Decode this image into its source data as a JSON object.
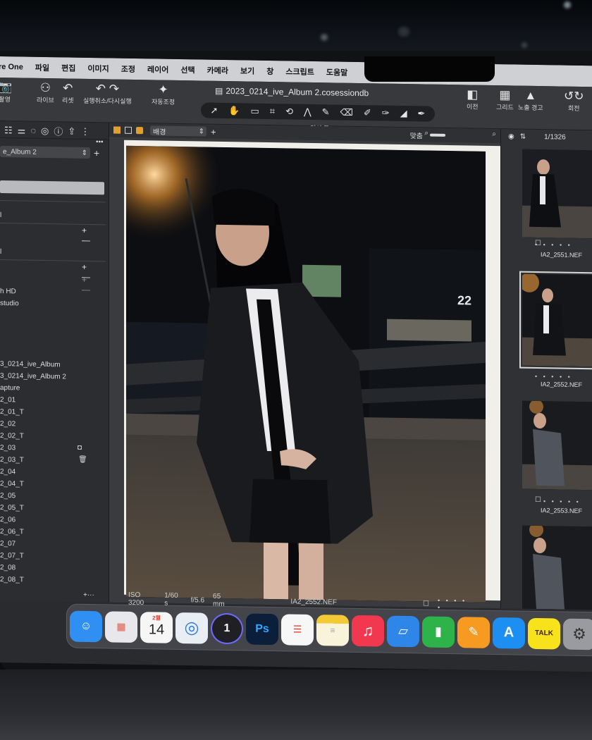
{
  "menu": {
    "app_name": "re One",
    "items": [
      "파일",
      "편집",
      "이미지",
      "조정",
      "레이어",
      "선택",
      "카메라",
      "보기",
      "창",
      "스크립트",
      "도움말"
    ]
  },
  "toolbar": {
    "document_title": "2023_0214_ive_Album 2.cosessiondb",
    "buttons": {
      "capture": "촬영",
      "live": "라이브",
      "reset": "리셋",
      "undo_redo": "실행취소/다시실행",
      "auto_adjust": "자동조정",
      "before": "이전",
      "grid": "그리드",
      "exposure_warning": "노출 경고",
      "rotate": "회전"
    },
    "cursor_tools_label": "커서 툴"
  },
  "left_panel": {
    "session_select": "e_Album 2",
    "rows": [
      "h HD",
      "studio",
      "3_0214_ive_Album",
      "3_0214_ive_Album 2",
      "apture",
      "2_01",
      "2_01_T",
      "2_02",
      "2_02_T",
      "2_03",
      "2_03_T",
      "2_04",
      "2_04_T",
      "2_05",
      "2_05_T",
      "2_06",
      "2_06_T",
      "2_07",
      "2_07_T",
      "2_08",
      "2_08_T"
    ],
    "plus_minus": "+ —",
    "footer_plus": "+···"
  },
  "viewer": {
    "style_select": "배경",
    "fit_label": "맞춤",
    "image_count": "1/1326",
    "iso": "ISO 3200",
    "shutter": "1/60 s",
    "aperture": "f/5.6",
    "focal_length": "65 mm",
    "filename": "IA2_2552.NEF",
    "sign_number": "22"
  },
  "browser": {
    "thumbnails": [
      {
        "name": "IA2_2551.NEF",
        "selected": false
      },
      {
        "name": "IA2_2552.NEF",
        "selected": true
      },
      {
        "name": "IA2_2553.NEF",
        "selected": false
      },
      {
        "name": "",
        "selected": false
      }
    ],
    "rating_dots": "• • • • •"
  },
  "dock": {
    "apps": [
      {
        "name": "Finder",
        "icon": "finder-icon",
        "color": "#2f8ff3"
      },
      {
        "name": "Launchpad",
        "icon": "launchpad-icon",
        "color": "#e8e8ec"
      },
      {
        "name": "Calendar",
        "icon": "calendar-icon",
        "color": "#f6f6f6",
        "month": "2월",
        "day": "14"
      },
      {
        "name": "Safari",
        "icon": "safari-icon",
        "color": "#e9eef4"
      },
      {
        "name": "Capture One",
        "icon": "capture-one-icon",
        "color": "#1f1f24",
        "label": "1"
      },
      {
        "name": "Photoshop",
        "icon": "photoshop-icon",
        "color": "#0b1e3a",
        "label": "Ps"
      },
      {
        "name": "Reminders",
        "icon": "reminders-icon",
        "color": "#f7f7f7"
      },
      {
        "name": "Notes",
        "icon": "notes-icon",
        "color": "#f8f3d9"
      },
      {
        "name": "Music",
        "icon": "music-icon",
        "color": "#f2384f"
      },
      {
        "name": "Keynote",
        "icon": "keynote-icon",
        "color": "#2e86e8"
      },
      {
        "name": "Numbers",
        "icon": "numbers-icon",
        "color": "#2db34a"
      },
      {
        "name": "Pages",
        "icon": "pages-icon",
        "color": "#f79a22"
      },
      {
        "name": "App Store",
        "icon": "app-store-icon",
        "color": "#1d8ff2"
      },
      {
        "name": "KakaoTalk",
        "icon": "kakaotalk-icon",
        "color": "#f8e21b",
        "label": "TALK"
      },
      {
        "name": "System Settings",
        "icon": "settings-icon",
        "color": "#9a9ba0"
      }
    ]
  }
}
